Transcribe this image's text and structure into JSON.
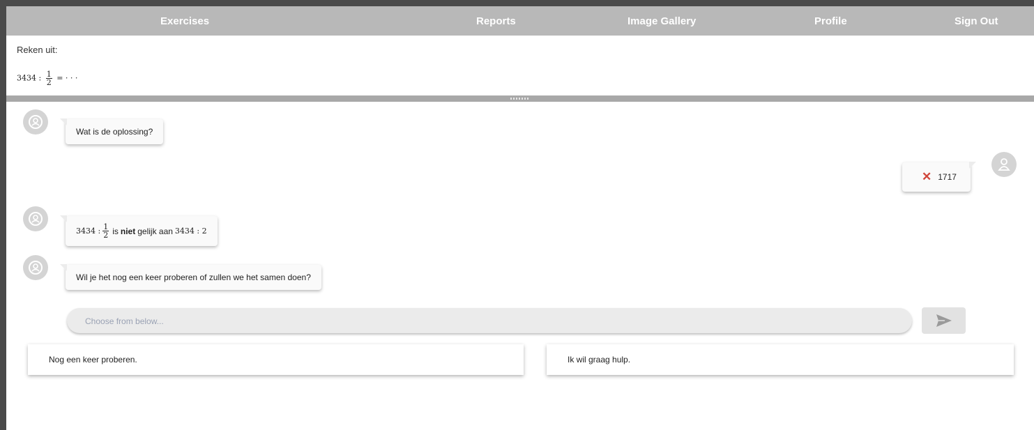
{
  "nav": {
    "exercises": "Exercises",
    "reports": "Reports",
    "image_gallery": "Image Gallery",
    "profile": "Profile",
    "sign_out": "Sign Out"
  },
  "exercise": {
    "prompt": "Reken uit:",
    "expr_left": "3434 :",
    "frac_num": "1",
    "frac_den": "2",
    "expr_right": "= · · ·"
  },
  "chat": {
    "msg1": "Wat is de oplossing?",
    "user_answer": "1717",
    "user_answer_status_icon": "x-icon",
    "msg2": {
      "left": "3434 :",
      "frac_num": "1",
      "frac_den": "2",
      "text_is": "is",
      "text_niet": "niet",
      "text_rest": "gelijk aan",
      "math_right": "3434 : 2"
    },
    "msg3": "Wil je het nog een keer proberen of zullen we het samen doen?"
  },
  "input": {
    "placeholder": "Choose from below..."
  },
  "options": [
    "Nog een keer proberen.",
    "Ik wil graag hulp."
  ],
  "colors": {
    "nav_bg": "#b8b8b8",
    "error_mark": "#d0453a",
    "frame": "#4a4a4a"
  }
}
